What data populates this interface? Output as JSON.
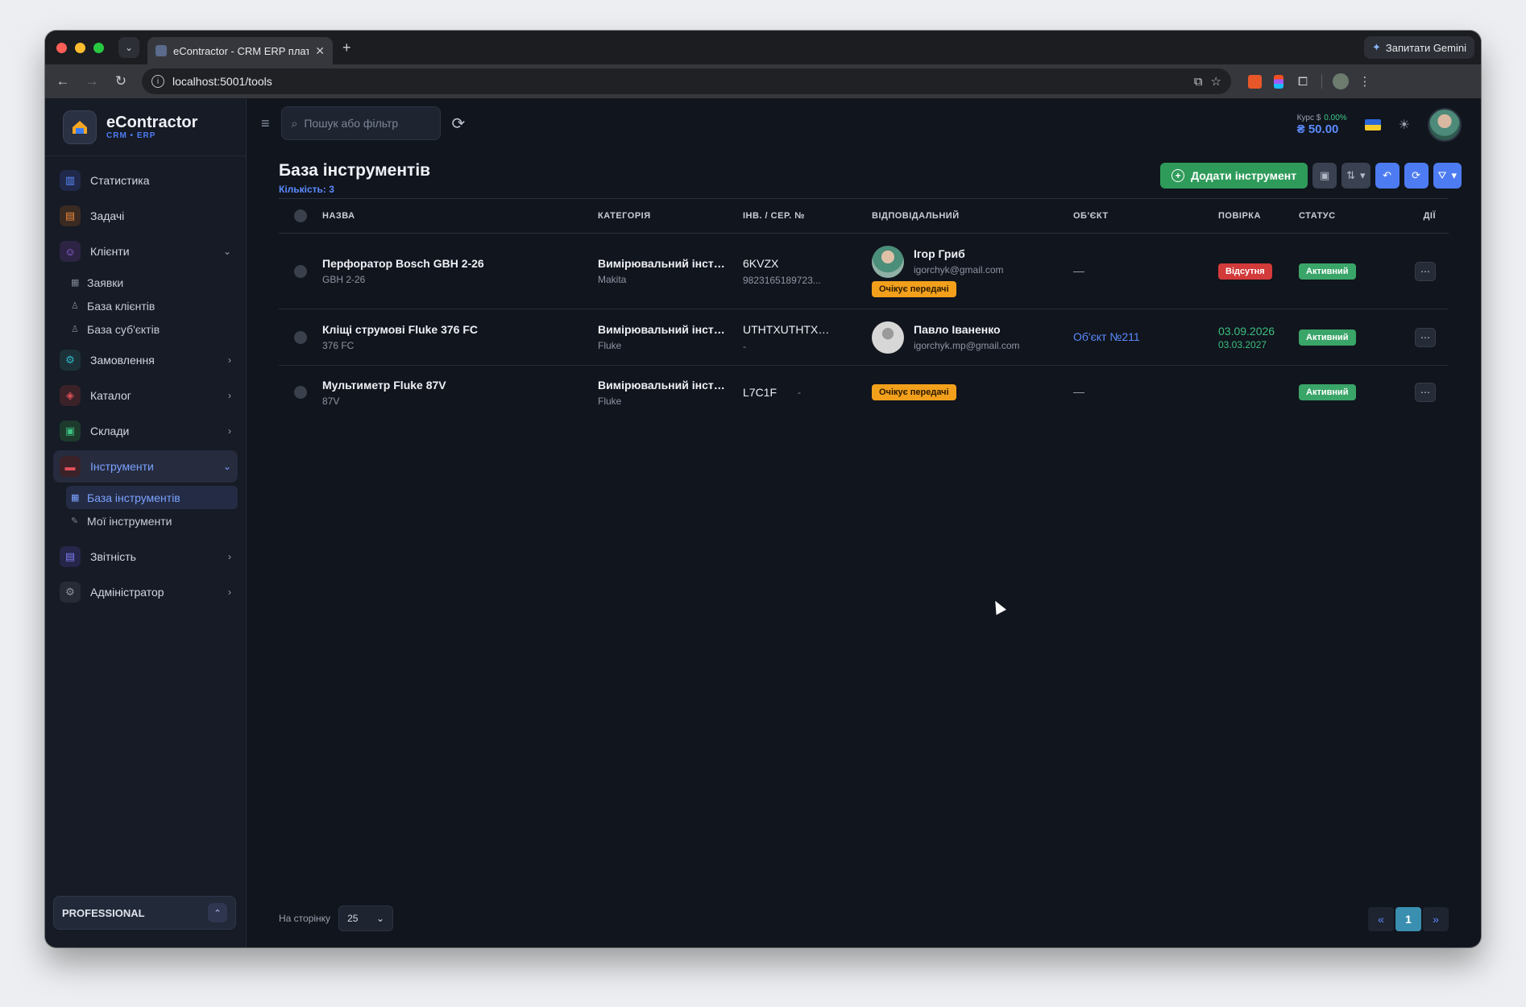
{
  "browser": {
    "tab_title": "eContractor - CRM ERP плат",
    "tab_close": "✕",
    "new_tab": "+",
    "gemini_label": "Запитати Gemini",
    "url": "localhost:5001/tools"
  },
  "brand": {
    "name": "eContractor",
    "sub": "CRM • ERP"
  },
  "sidebar": {
    "items": [
      {
        "label": "Статистика",
        "icon": "bar-chart-icon",
        "color": "#5b8bff"
      },
      {
        "label": "Задачі",
        "icon": "clipboard-icon",
        "color": "#f08a3a"
      },
      {
        "label": "Клієнти",
        "icon": "users-icon",
        "color": "#a36bf5"
      },
      {
        "label": "Замовлення",
        "icon": "gear-icon",
        "color": "#2fb8c9"
      },
      {
        "label": "Каталог",
        "icon": "box-icon",
        "color": "#e0505a"
      },
      {
        "label": "Склади",
        "icon": "warehouse-icon",
        "color": "#3cbf80"
      },
      {
        "label": "Інструменти",
        "icon": "toolbox-icon",
        "color": "#e0505a"
      },
      {
        "label": "Звітність",
        "icon": "report-icon",
        "color": "#7d7df5"
      },
      {
        "label": "Адміністратор",
        "icon": "settings-icon",
        "color": "#8d95a4"
      }
    ],
    "clients_sub": [
      "Заявки",
      "База клієнтів",
      "База суб'єктів"
    ],
    "tools_sub": [
      "База інструментів",
      "Мої інструменти"
    ],
    "plan": "PROFESSIONAL"
  },
  "topbar": {
    "search_placeholder": "Пошук або фільтр",
    "rate_label": "Курс $",
    "rate_change": "0.00%",
    "rate_value": "₴ 50.00"
  },
  "page": {
    "title": "База інструментів",
    "count": "Кількість: 3",
    "add_button": "Додати інструмент"
  },
  "table": {
    "headers": {
      "name": "НАЗВА",
      "category": "КАТЕГОРІЯ",
      "inv": "ІНВ. / СЕР. №",
      "resp": "ВІДПОВІДАЛЬНИЙ",
      "object": "ОБ'ЄКТ",
      "check": "ПОВІРКА",
      "status": "СТАТУС",
      "actions": "ДІЇ"
    },
    "rows": [
      {
        "name": "Перфоратор Bosch GBH 2-26",
        "model": "GBH 2-26",
        "category": "Вимірювальний інструмент",
        "brand": "Makita",
        "inv": "6KVZX",
        "serial": "9823165189723...",
        "resp_name": "Ігор Гриб",
        "resp_email": "igorchyk@gmail.com",
        "resp_badge": "Очікує передачі",
        "object": "—",
        "check_badge": "Відсутня",
        "status": "Активний"
      },
      {
        "name": "Кліщі струмові Fluke 376 FC",
        "model": "376 FC",
        "category": "Вимірювальний інструмент",
        "brand": "Fluke",
        "inv": "UTHTXUTHTXUTHTX",
        "serial": "-",
        "resp_name": "Павло Іваненко",
        "resp_email": "igorchyk.mp@gmail.com",
        "object": "Об'єкт №211",
        "check_date": "03.09.2026",
        "check_next": "03.03.2027",
        "status": "Активний"
      },
      {
        "name": "Мультиметр Fluke 87V",
        "model": "87V",
        "category": "Вимірювальний інструмент",
        "brand": "Fluke",
        "inv": "L7C1F",
        "serial": "-",
        "resp_badge": "Очікує передачі",
        "object": "—",
        "status": "Активний"
      }
    ]
  },
  "pagination": {
    "per_page_label": "На сторінку",
    "per_page": "25",
    "prev": "«",
    "current": "1",
    "next": "»"
  }
}
